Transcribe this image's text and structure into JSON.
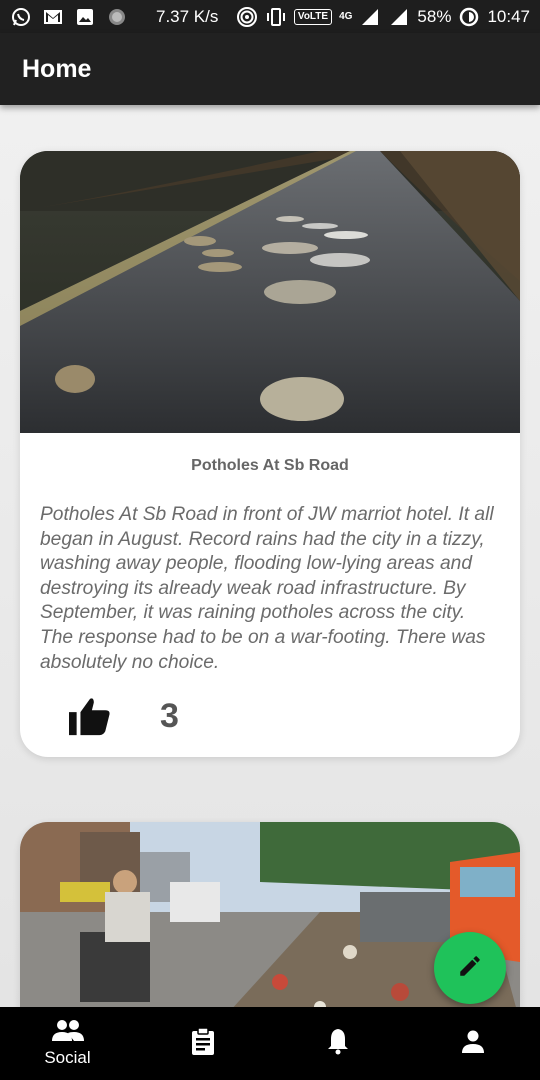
{
  "status_bar": {
    "speed": "7.37 K/s",
    "volte": "VoLTE",
    "network": "4G",
    "battery": "58%",
    "time": "10:47",
    "icons": [
      "whatsapp-icon",
      "gmail-icon",
      "gallery-icon",
      "circle-icon",
      "hotspot-icon",
      "vibrate-icon",
      "signal-icon",
      "battery-icon"
    ]
  },
  "app_bar": {
    "title": "Home"
  },
  "posts": [
    {
      "title": "Potholes At Sb Road",
      "description": "Potholes At Sb Road in front of JW marriot hotel. It all began in August. Record rains had the city in a tizzy, washing away people, flooding low-lying areas and destroying its already weak road infrastructure. By September, it was raining potholes across the city. The response had to be on a war-footing. There was absolutely no choice.",
      "likes": "3",
      "image": "pothole-road-photo"
    },
    {
      "image": "garbage-street-photo"
    }
  ],
  "fab": {
    "icon": "pencil-icon",
    "color": "#1fc25a"
  },
  "bottom_nav": {
    "items": [
      {
        "label": "Social",
        "icon": "people-icon"
      },
      {
        "label": "",
        "icon": "clipboard-icon"
      },
      {
        "label": "",
        "icon": "bell-icon"
      },
      {
        "label": "",
        "icon": "person-icon"
      }
    ]
  }
}
